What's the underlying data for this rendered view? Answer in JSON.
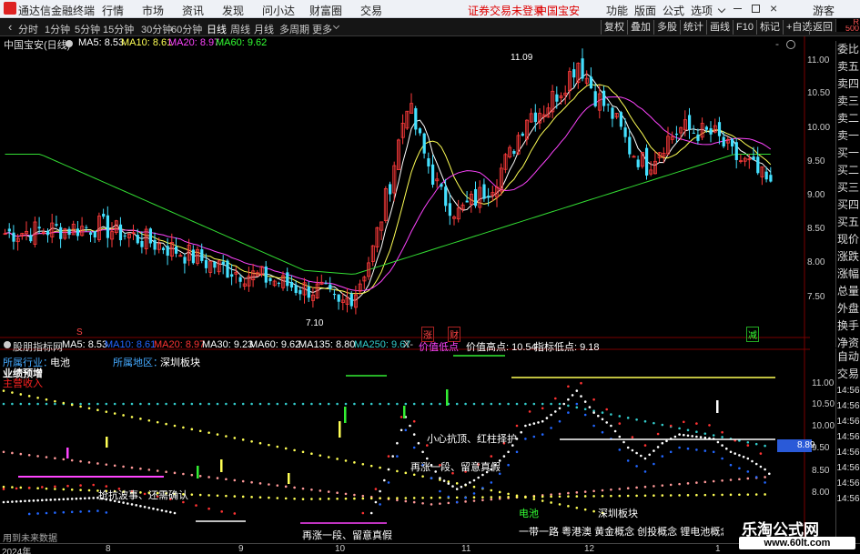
{
  "menubar": {
    "app_title": "通达信金融终端",
    "items": [
      "行情",
      "市场",
      "资讯",
      "发现",
      "问小达",
      "财富圈",
      "交易"
    ],
    "alert": "证券交易未登录",
    "stock": "中国宝安",
    "right_items": [
      "功能",
      "版面",
      "公式",
      "选项"
    ],
    "guest": "游客"
  },
  "toolbar": {
    "periods": [
      "分时",
      "1分钟",
      "5分钟",
      "15分钟",
      "30分钟",
      "60分钟",
      "日线",
      "周线",
      "月线",
      "多周期",
      "更多"
    ],
    "active": "日线",
    "right": [
      "复权",
      "叠加",
      "多股",
      "统计",
      "画线",
      "F10",
      "标记",
      "+自选",
      "返回"
    ]
  },
  "kline_header": {
    "stock_period": "中国宝安(日线)",
    "ma": [
      {
        "label": "MA5: 8.53",
        "color": "#ffffff"
      },
      {
        "label": "MA10: 8.61",
        "color": "#ffff55"
      },
      {
        "label": "MA20: 8.97",
        "color": "#ff44ff"
      },
      {
        "label": "MA60: 9.62",
        "color": "#33ff33"
      }
    ]
  },
  "kline": {
    "y_ticks": [
      "11.00",
      "10.50",
      "10.00",
      "9.50",
      "9.00",
      "8.50",
      "8.00",
      "7.50"
    ],
    "high_label": "11.09",
    "low_label": "7.10",
    "markers": [
      "S",
      "涨",
      "财",
      "减"
    ]
  },
  "indicator_header": {
    "name": "股朋指标网",
    "items": [
      {
        "label": "MA5: 8.53",
        "color": "#ffffff"
      },
      {
        "label": "MA10: 8.61",
        "color": "#2266ff"
      },
      {
        "label": "MA20: 8.97",
        "color": "#ff3333"
      },
      {
        "label": "MA30: 9.23",
        "color": "#ffffff"
      },
      {
        "label": "MA60: 9.62",
        "color": "#ffffff"
      },
      {
        "label": "MA135: 8.80",
        "color": "#ffffff"
      },
      {
        "label": "MA250: 9.67",
        "color": "#33cccc"
      },
      {
        "label": "X-",
        "color": "#cccccc"
      },
      {
        "label": "价值低点",
        "color": "#ff44ff"
      },
      {
        "label": "价值高点: 10.54",
        "color": "#ffffff"
      },
      {
        "label": "指标低点: 9.18",
        "color": "#ffffff"
      }
    ]
  },
  "indicator": {
    "industry_label": "所属行业：",
    "industry": "电池",
    "region_label": "所属地区：",
    "region": "深圳板块",
    "tag1": "业绩预增",
    "tag2": "主营收入",
    "annotations": [
      "小心抗顶、红柱择护",
      "再涨一段、留意真假",
      "抢抗波事、还需确认",
      "再涨一段、留意真假"
    ],
    "sector_tag1": "电池",
    "sector_tag2": "深圳板块",
    "concepts": "一带一路 粤港澳 黄金概念 创投概念 锂电池概念 固态",
    "future_data": "用到未来数据",
    "y_ticks": [
      "11.00",
      "10.50",
      "10.00",
      "9.50",
      "9.00",
      "8.50",
      "8.00"
    ],
    "current_price": "8.89"
  },
  "right_panel_top": {
    "label_r": "R",
    "label_500": "500",
    "items": [
      "委比",
      "卖五",
      "卖四",
      "卖三",
      "卖二",
      "卖一",
      "买一",
      "买二",
      "买三",
      "买四",
      "买五",
      "现价",
      "涨跌",
      "涨幅",
      "总量",
      "外盘",
      "换手",
      "净资",
      "收益"
    ]
  },
  "right_panel_bottom": {
    "items": [
      "自动",
      "交易"
    ],
    "times": [
      "14:56",
      "14:56",
      "14:56",
      "14:56",
      "14:56",
      "14:56",
      "14:56",
      "14:56"
    ]
  },
  "bottom": {
    "labels": [
      "2024年",
      "8",
      "9",
      "10",
      "11",
      "12",
      "1"
    ]
  },
  "watermark": {
    "title": "乐淘公式网",
    "url": "www.60lt.com"
  }
}
